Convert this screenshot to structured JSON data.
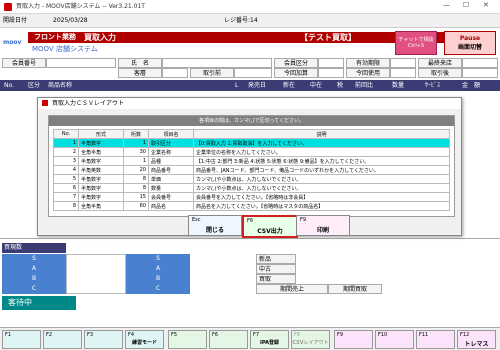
{
  "window": {
    "title": "買取入力 - MOOV店舗システム -- Ver3.21.01T",
    "minimize": "—",
    "maximize": "☐",
    "close": "✕"
  },
  "infobar": {
    "date_label": "開設日付",
    "date_value": "2025/03/28",
    "register": "レジ番号:14"
  },
  "header": {
    "company": "フロント業務",
    "screen_title": "買取入力",
    "mode_badge": "【テスト買取】",
    "brand_logo": "moov",
    "system_name": "MOOV 店舗システム",
    "chat_button": "チャットで相談",
    "chat_sub": "Ctrl+S",
    "pause_button": "Pause",
    "pause_sub": "画面切替",
    "accent": "#b00000"
  },
  "customer": {
    "member_no": "会員番号",
    "name": "氏　名",
    "member_type": "会員区分",
    "valid_term": "有効期限",
    "last_visit": "最終来店",
    "customer": "客層",
    "trade_type": "取引前",
    "this_time": "今回加算",
    "this_use": "今回使用",
    "discount": "取引後"
  },
  "columns": [
    "No.",
    "区分",
    "商品名称",
    "L",
    "発売日",
    "新在",
    "中在",
    "税",
    "前回比",
    "数量",
    "ｻｰﾋﾞｽ",
    "金　額"
  ],
  "sidebar": {
    "title": "買現数",
    "rows": [
      "S",
      "A",
      "B",
      "C"
    ],
    "rows2": [
      "S",
      "A",
      "B",
      "C"
    ],
    "status": "客待中"
  },
  "stock": {
    "new": "新品",
    "used": "中古",
    "buy": "買取",
    "period_sales": "期間売上",
    "period_buy": "期間買取"
  },
  "dialog": {
    "title": "買取入力ＣＳＶレイアウト",
    "hint": "各項目の間は、カンマ(,)で区切ってください。",
    "headers": [
      "No.",
      "形式",
      "桁数",
      "項目名",
      "説明"
    ],
    "rows": [
      [
        "1",
        "半角数字",
        "1",
        "取引区分",
        "【0:買取入力 1:買取取消】を入力してください。"
      ],
      [
        "2",
        "全角半角",
        "30",
        "企業名称",
        "企業単位の名称を入力してください。"
      ],
      [
        "3",
        "半角数字",
        "1",
        "品種",
        "【1:中古 2:部門 3:新品 4:状態 5:状態 6:状態 9:備品】を入力してください。"
      ],
      [
        "4",
        "半角英数",
        "20",
        "商品番号",
        "商品番号、JANコード、部門コード、備品コードのいずれかを入力してください。"
      ],
      [
        "5",
        "半角数字",
        "8",
        "単価",
        "カンマ(,)や小数点は、入力しないでください。"
      ],
      [
        "6",
        "半角数字",
        "8",
        "数量",
        "カンマ(,)や小数点は、入力しないでください。"
      ],
      [
        "7",
        "半角数字",
        "15",
        "会員番号",
        "会員番号を入力してください。【省略時は非会員】"
      ],
      [
        "8",
        "全角半角",
        "60",
        "商品名",
        "商品名を入力してください。【省略時はマスタの商品名】"
      ]
    ],
    "buttons": [
      {
        "key": "Esc",
        "label": "閉じる"
      },
      {
        "key": "F6",
        "label": "CSV出力"
      },
      {
        "key": "F9",
        "label": "印刷"
      }
    ]
  },
  "fkeys": [
    {
      "key": "F1",
      "label": ""
    },
    {
      "key": "F2",
      "label": ""
    },
    {
      "key": "F3",
      "label": ""
    },
    {
      "key": "F4",
      "label": "練習モード"
    },
    {
      "key": "F5",
      "label": ""
    },
    {
      "key": "F6",
      "label": ""
    },
    {
      "key": "F7",
      "label": "IPA登録"
    },
    {
      "key": "F8",
      "label": "CSVレイアウト"
    },
    {
      "key": "F9",
      "label": ""
    },
    {
      "key": "F10",
      "label": ""
    },
    {
      "key": "F11",
      "label": ""
    },
    {
      "key": "F12",
      "label": "トレマス"
    }
  ]
}
